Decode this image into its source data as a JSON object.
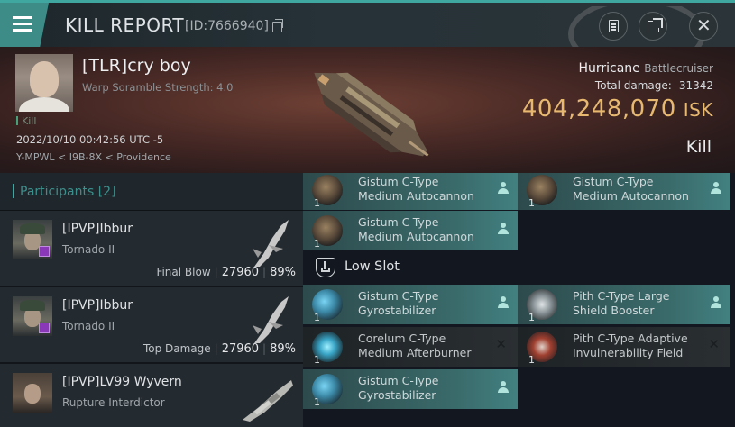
{
  "header": {
    "title": "KILL REPORT",
    "kill_id": "[ID:7666940]"
  },
  "victim": {
    "name": "[TLR]cry boy",
    "warp_scramble": "Warp Soramble Strength: 4.0",
    "tag": "Kill",
    "timestamp": "2022/10/10 00:42:56 UTC -5",
    "location": "Y-MPWL < I9B-8X < Providence",
    "ship": "Hurricane",
    "ship_class": "Battlecruiser",
    "total_damage_label": "Total damage:",
    "total_damage": "31342",
    "isk_value": "404,248,070",
    "isk_unit": "ISK",
    "outcome": "Kill"
  },
  "participants": {
    "label": "Participants",
    "count": "[2]",
    "rows": [
      {
        "name": "[IPVP]Ibbur",
        "ship": "Tornado II",
        "role": "Final Blow",
        "damage": "27960",
        "percent": "89%"
      },
      {
        "name": "[IPVP]Ibbur",
        "ship": "Tornado II",
        "role": "Top Damage",
        "damage": "27960",
        "percent": "89%"
      },
      {
        "name": "[IPVP]LV99 Wyvern",
        "ship": "Rupture Interdictor"
      }
    ]
  },
  "modules": {
    "top": [
      {
        "name_line1": "Gistum C-Type",
        "name_line2": "Medium Autocannon",
        "qty": "1",
        "state": "dropped",
        "icon": "autocannon-icon"
      },
      {
        "name_line1": "Gistum C-Type",
        "name_line2": "Medium Autocannon",
        "qty": "1",
        "state": "dropped",
        "icon": "autocannon-icon"
      },
      {
        "name_line1": "Gistum C-Type",
        "name_line2": "Medium Autocannon",
        "qty": "1",
        "state": "dropped",
        "icon": "autocannon-icon"
      }
    ],
    "low_slot_label": "Low Slot",
    "low": [
      {
        "name_line1": "Gistum C-Type",
        "name_line2": "Gyrostabilizer",
        "qty": "1",
        "state": "dropped",
        "icon": "gyrostabilizer-icon"
      },
      {
        "name_line1": "Pith C-Type Large",
        "name_line2": "Shield Booster",
        "qty": "1",
        "state": "dropped",
        "icon": "shield-booster-icon"
      },
      {
        "name_line1": "Corelum C-Type",
        "name_line2": "Medium Afterburner",
        "qty": "1",
        "state": "destroyed",
        "icon": "afterburner-icon"
      },
      {
        "name_line1": "Pith C-Type Adaptive",
        "name_line2": "Invulnerability Field",
        "qty": "1",
        "state": "destroyed",
        "icon": "invulnerability-field-icon"
      },
      {
        "name_line1": "Gistum C-Type",
        "name_line2": "Gyrostabilizer",
        "qty": "1",
        "state": "dropped",
        "icon": "gyrostabilizer-icon"
      }
    ]
  },
  "colors": {
    "accent_teal": "#3fa6a0",
    "isk_gold": "#e6b870",
    "corp_purple": "#8a38b8",
    "dropped_teal": "#3a6a6a",
    "destroyed_dark": "#2a2f32"
  }
}
